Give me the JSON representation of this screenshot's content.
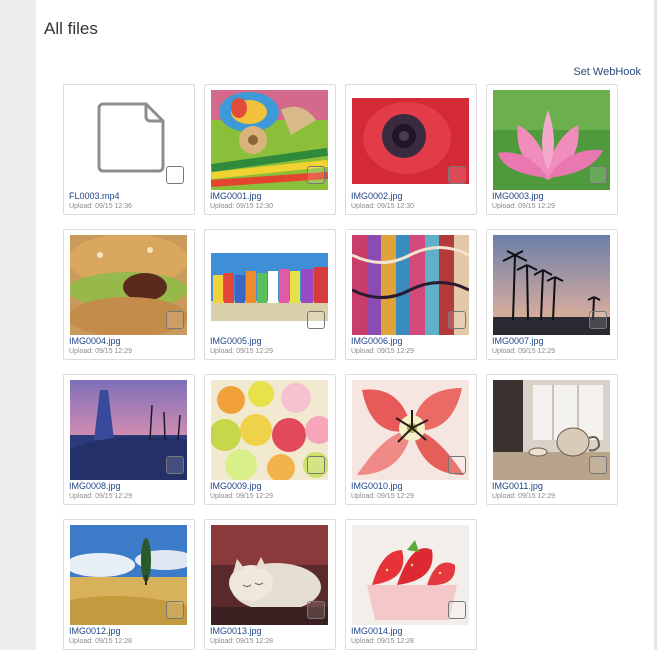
{
  "header": {
    "title": "All files",
    "webhook_label": "Set WebHook"
  },
  "files": [
    {
      "name": "FL0003.mp4",
      "upload": "Upload: 09/15 12:36",
      "icon": "file-icon"
    },
    {
      "name": "IMG0001.jpg",
      "upload": "Upload: 09/15 12:30"
    },
    {
      "name": "IMG0002.jpg",
      "upload": "Upload: 09/15 12:30"
    },
    {
      "name": "IMG0003.jpg",
      "upload": "Upload: 09/15 12:29"
    },
    {
      "name": "IMG0004.jpg",
      "upload": "Upload: 09/15 12:29"
    },
    {
      "name": "IMG0005.jpg",
      "upload": "Upload: 09/15 12:29"
    },
    {
      "name": "IMG0006.jpg",
      "upload": "Upload: 09/15 12:29"
    },
    {
      "name": "IMG0007.jpg",
      "upload": "Upload: 09/15 12:29"
    },
    {
      "name": "IMG0008.jpg",
      "upload": "Upload: 09/15 12:29"
    },
    {
      "name": "IMG0009.jpg",
      "upload": "Upload: 09/15 12:29"
    },
    {
      "name": "IMG0010.jpg",
      "upload": "Upload: 09/15 12:29"
    },
    {
      "name": "IMG0011.jpg",
      "upload": "Upload: 09/15 12:29"
    },
    {
      "name": "IMG0012.jpg",
      "upload": "Upload: 09/15 12:28"
    },
    {
      "name": "IMG0013.jpg",
      "upload": "Upload: 09/15 12:28"
    },
    {
      "name": "IMG0014.jpg",
      "upload": "Upload: 09/15 12:28"
    }
  ],
  "colors": {
    "link": "#22468a",
    "border": "#dcdcdc",
    "rail": "#ececec"
  }
}
